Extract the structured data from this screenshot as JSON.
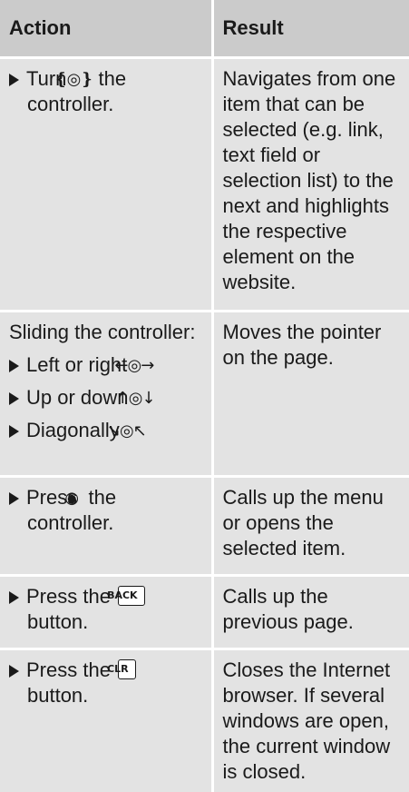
{
  "header": {
    "action": "Action",
    "result": "Result"
  },
  "rows": [
    {
      "action": {
        "prefix": "Turn",
        "glyph": "❴◎❵",
        "suffix": "the controller."
      },
      "result": "Navigates from one item that can be selected (e.g. link, text field or selection list) to the next and highlights the respective element on the website."
    },
    {
      "action": {
        "intro": "Sliding the controller:",
        "items": [
          {
            "label": "Left or right",
            "glyph": "←◎→"
          },
          {
            "label": "Up or down",
            "glyph": "↑◎↓"
          },
          {
            "label": "Diagonally",
            "glyph": "↘◎↖"
          }
        ]
      },
      "result": "Moves the pointer on the page."
    },
    {
      "action": {
        "prefix": "Press",
        "glyph": "◉",
        "suffix": "the controller."
      },
      "result": "Calls up the menu or opens the selected item."
    },
    {
      "action": {
        "prefix": "Press the",
        "key": "BACK",
        "suffix": "button."
      },
      "result": "Calls up the previous page."
    },
    {
      "action": {
        "prefix": "Press the",
        "key": "CLR",
        "suffix": "button."
      },
      "result": "Closes the Internet browser. If several windows are open, the current window is closed."
    }
  ],
  "icons": [
    "rotate-controller-icon",
    "slide-left-right-icon",
    "slide-up-down-icon",
    "slide-diagonal-icon",
    "press-controller-icon"
  ],
  "colors": {
    "header_bg": "#cbcbcb",
    "cell_bg": "#e3e3e3",
    "divider": "#ffffff"
  }
}
